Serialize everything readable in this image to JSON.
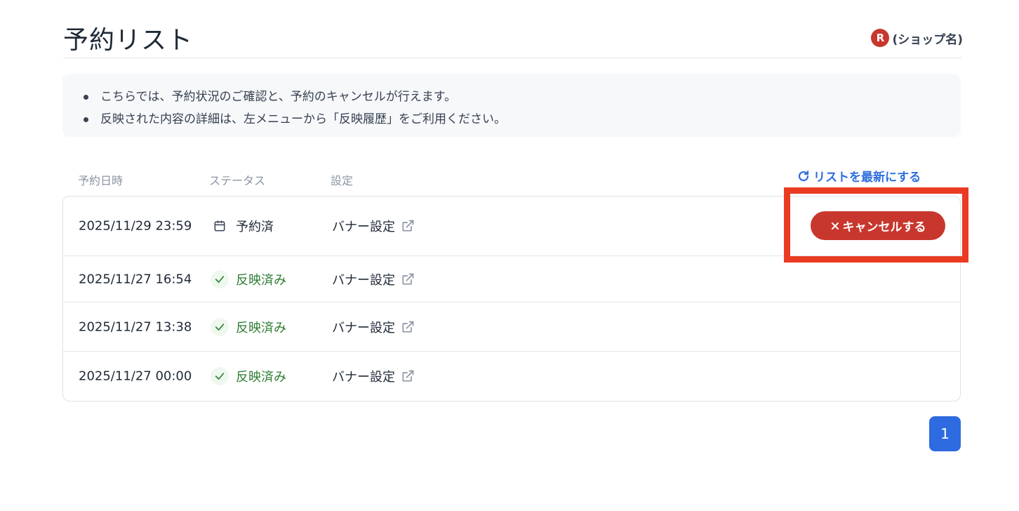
{
  "header": {
    "title": "予約リスト",
    "shop_logo_letter": "R",
    "shop_name": "(ショップ名)"
  },
  "notice": {
    "items": [
      "こちらでは、予約状況のご確認と、予約のキャンセルが行えます。",
      "反映された内容の詳細は、左メニューから「反映履歴」をご利用ください。"
    ]
  },
  "table": {
    "columns": {
      "date": "予約日時",
      "status": "ステータス",
      "setting": "設定"
    },
    "refresh_label": "リストを最新にする",
    "rows": [
      {
        "date": "2025/11/29 23:59",
        "status": "予約済",
        "setting": "バナー設定"
      },
      {
        "date": "2025/11/27 16:54",
        "status": "反映済み",
        "setting": "バナー設定"
      },
      {
        "date": "2025/11/27 13:38",
        "status": "反映済み",
        "setting": "バナー設定"
      },
      {
        "date": "2025/11/27 00:00",
        "status": "反映済み",
        "setting": "バナー設定"
      }
    ],
    "cancel_label": "キャンセルする"
  },
  "pagination": {
    "current_page": "1"
  },
  "colors": {
    "accent_blue": "#2f6be0",
    "cancel_red": "#c8372d",
    "done_green": "#2e7d32",
    "highlight": "#ea3b22"
  },
  "icons": {
    "refresh": "refresh-icon",
    "calendar": "calendar-icon",
    "check": "check-icon",
    "external": "external-link-icon",
    "close": "close-icon"
  }
}
